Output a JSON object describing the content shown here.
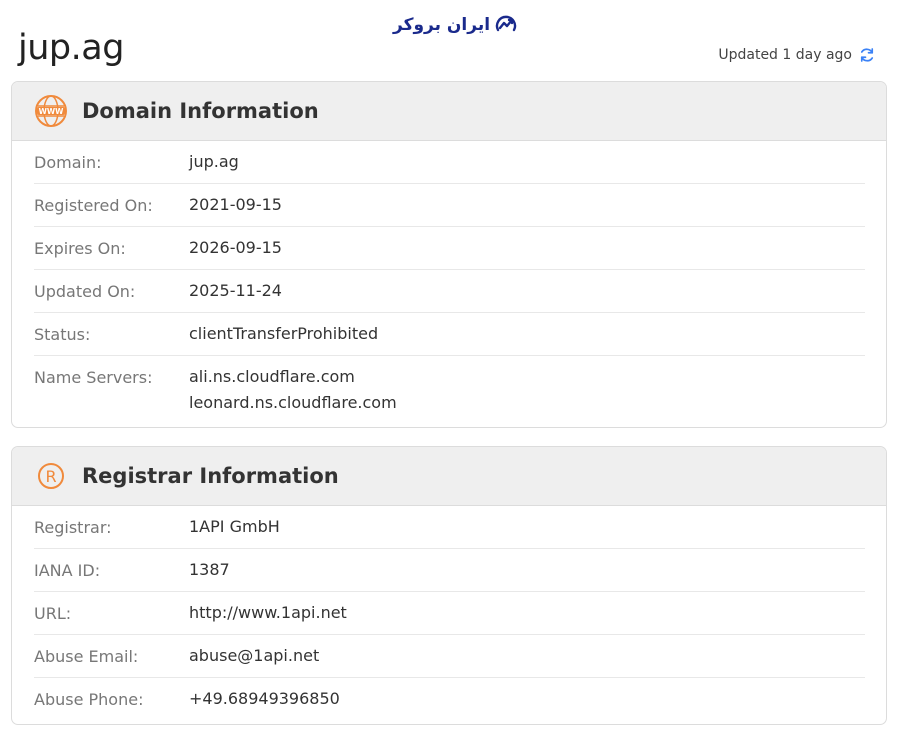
{
  "brand": {
    "name": "ایران بروکر",
    "color": "#1a2a8c"
  },
  "page": {
    "title": "jup.ag",
    "updated_text": "Updated 1 day ago",
    "refresh_icon": "refresh-icon",
    "accent_color": "#3b82f6"
  },
  "domain_info": {
    "title": "Domain Information",
    "icon": "www-globe-icon",
    "icon_color": "#f08a3c",
    "rows": [
      {
        "label": "Domain:",
        "value": "jup.ag"
      },
      {
        "label": "Registered On:",
        "value": "2021-09-15"
      },
      {
        "label": "Expires On:",
        "value": "2026-09-15"
      },
      {
        "label": "Updated On:",
        "value": "2025-11-24"
      },
      {
        "label": "Status:",
        "value": "clientTransferProhibited"
      },
      {
        "label": "Name Servers:",
        "values": [
          "ali.ns.cloudflare.com",
          "leonard.ns.cloudflare.com"
        ]
      }
    ]
  },
  "registrar_info": {
    "title": "Registrar Information",
    "icon": "registered-icon",
    "icon_color": "#f08a3c",
    "rows": [
      {
        "label": "Registrar:",
        "value": "1API GmbH"
      },
      {
        "label": "IANA ID:",
        "value": "1387"
      },
      {
        "label": "URL:",
        "value": "http://www.1api.net"
      },
      {
        "label": "Abuse Email:",
        "value": "abuse@1api.net"
      },
      {
        "label": "Abuse Phone:",
        "value": "+49.68949396850"
      }
    ]
  }
}
